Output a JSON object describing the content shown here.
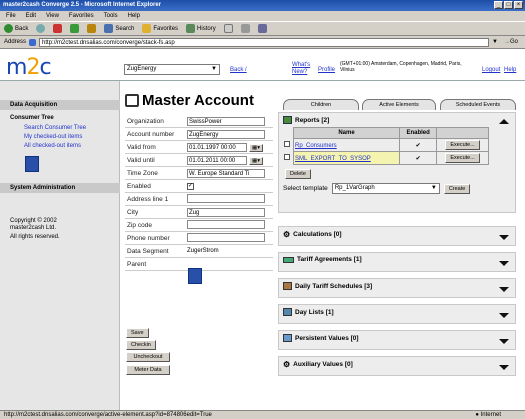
{
  "window": {
    "title": "master2cash Converge 2.5 - Microsoft Internet Explorer"
  },
  "menu": [
    "File",
    "Edit",
    "View",
    "Favorites",
    "Tools",
    "Help"
  ],
  "toolbar": {
    "back": "Back",
    "search": "Search",
    "favorites": "Favorites",
    "history": "History"
  },
  "address": {
    "label": "Address",
    "url": "http://m2ctest.dnsalias.com/converge/stack-fs.asp",
    "go": "Go"
  },
  "header": {
    "account_select": "ZugEnergy",
    "back_link": "Back /",
    "whats_new": "What's New?",
    "profile": "Profile",
    "timezone": "(GMT+01:00) Amsterdam, Copenhagen, Madrid, Paris, Vilnius",
    "logout": "Logout",
    "help": "Help"
  },
  "logo": {
    "m": "m",
    "two": "2",
    "c": "c"
  },
  "sidebar": {
    "data_acquisition": "Data Acquisition",
    "consumer_tree": "Consumer Tree",
    "links": [
      "Search Consumer Tree",
      "My checked-out items",
      "All checked-out items"
    ],
    "system_admin": "System Administration",
    "copyright": "Copyright © 2002 master2cash Ltd.",
    "rights": "All rights reserved."
  },
  "main": {
    "title": "Master Account",
    "tabs": [
      "Children",
      "Active Elements",
      "Scheduled Events"
    ],
    "fields": [
      {
        "label": "Organization",
        "value": "SwissPower"
      },
      {
        "label": "Account number",
        "value": "ZugEnergy"
      },
      {
        "label": "Valid from",
        "value": "01.01.1997 00:00"
      },
      {
        "label": "Valid until",
        "value": "01.01.2011 00:00"
      },
      {
        "label": "Time Zone",
        "value": "W. Europe Standard Ti"
      },
      {
        "label": "Enabled",
        "value": ""
      },
      {
        "label": "Address line 1",
        "value": ""
      },
      {
        "label": "City",
        "value": "Zug"
      },
      {
        "label": "Zip code",
        "value": ""
      },
      {
        "label": "Phone number",
        "value": ""
      },
      {
        "label": "Data Segment",
        "value": "ZugerStrom"
      },
      {
        "label": "Parent",
        "value": ""
      }
    ],
    "buttons": [
      "Save",
      "Checkin",
      "Uncheckout",
      "Meter Data"
    ]
  },
  "reports": {
    "title": "Reports [2]",
    "col_name": "Name",
    "col_enabled": "Enabled",
    "rows": [
      {
        "name": "Rp_Consumers",
        "enabled": "✔",
        "action": "Execute..."
      },
      {
        "name": "SML_EXPORT_TO_SYSOP",
        "enabled": "✔",
        "action": "Execute..."
      }
    ],
    "delete": "Delete",
    "template_label": "Select template",
    "template_value": "Rp_1VarGraph",
    "create": "Create"
  },
  "sections": [
    "Calculations [0]",
    "Tariff Agreements [1]",
    "Daily Tariff Schedules [3]",
    "Day Lists [1]",
    "Persistent Values [0]",
    "Auxiliary Values [0]"
  ],
  "status": {
    "url": "http://m2ctest.dnsalias.com/converge/active-element.asp?id=874806edit=True",
    "zone": "Internet"
  }
}
